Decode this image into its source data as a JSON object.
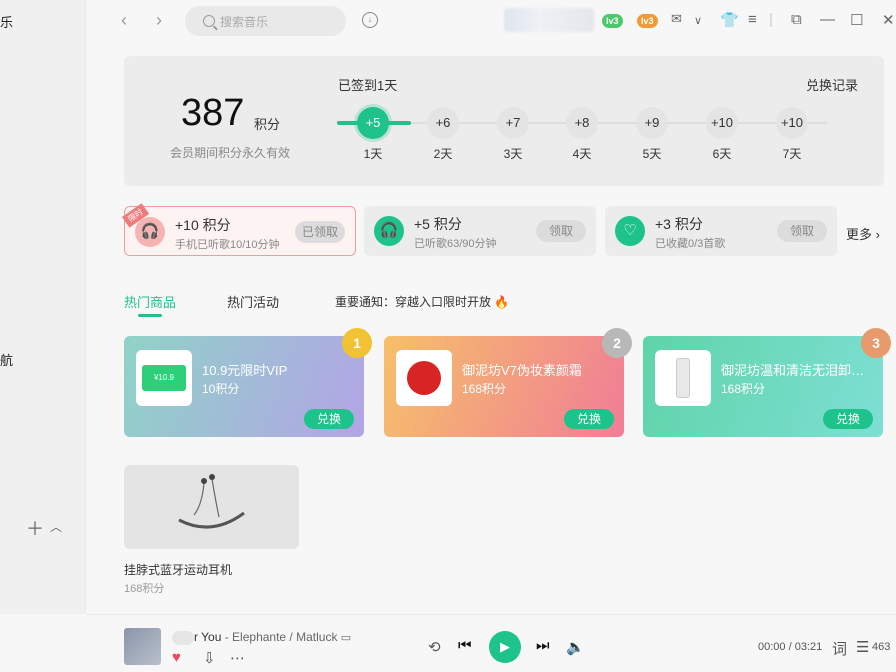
{
  "sidebar": {
    "frag_top": "乐",
    "frag_mid": "航"
  },
  "topbar": {
    "search_placeholder": "搜索音乐",
    "badge1": "lv3",
    "badge2": "lv3"
  },
  "points": {
    "value": "387",
    "unit": "积分",
    "subtitle": "会员期间积分永久有效",
    "checkin_status": "已签到1天",
    "exchange_record": "兑换记录",
    "days": [
      {
        "reward": "+5",
        "label": "1天"
      },
      {
        "reward": "+6",
        "label": "2天"
      },
      {
        "reward": "+7",
        "label": "3天"
      },
      {
        "reward": "+8",
        "label": "4天"
      },
      {
        "reward": "+9",
        "label": "5天"
      },
      {
        "reward": "+10",
        "label": "6天"
      },
      {
        "reward": "+10",
        "label": "7天"
      }
    ]
  },
  "tasks": [
    {
      "title": "+10 积分",
      "sub": "手机已听歌10/10分钟",
      "btn": "已领取",
      "ribbon": "限时"
    },
    {
      "title": "+5  积分",
      "sub": "已听歌63/90分钟",
      "btn": "领取"
    },
    {
      "title": "+3 积分",
      "sub": "已收藏0/3首歌",
      "btn": "领取"
    }
  ],
  "more_label": "更多",
  "tabs": {
    "hot_goods": "热门商品",
    "hot_activities": "热门活动",
    "notice": "重要通知：穿越入口限时开放"
  },
  "products": [
    {
      "title": "10.9元限时VIP",
      "price": "10积分",
      "btn": "兑换",
      "rank": "1",
      "thumb_text": "¥10.9"
    },
    {
      "title": "御泥坊V7伪妆素颜霜",
      "price": "168积分",
      "btn": "兑换",
      "rank": "2"
    },
    {
      "title": "御泥坊温和清洁无泪卸妆水",
      "price": "168积分",
      "btn": "兑换",
      "rank": "3"
    }
  ],
  "earphone": {
    "name": "挂脖式蓝牙运动耳机",
    "price": "168积分"
  },
  "player": {
    "song_title": "r You",
    "artist": "- Elephante / Matluck",
    "time": "00:00 / 03:21",
    "lyrics": "词",
    "playlist_count": "463"
  },
  "colors": {
    "accent": "#1ec28b",
    "ribbon": "#f07b7b"
  }
}
